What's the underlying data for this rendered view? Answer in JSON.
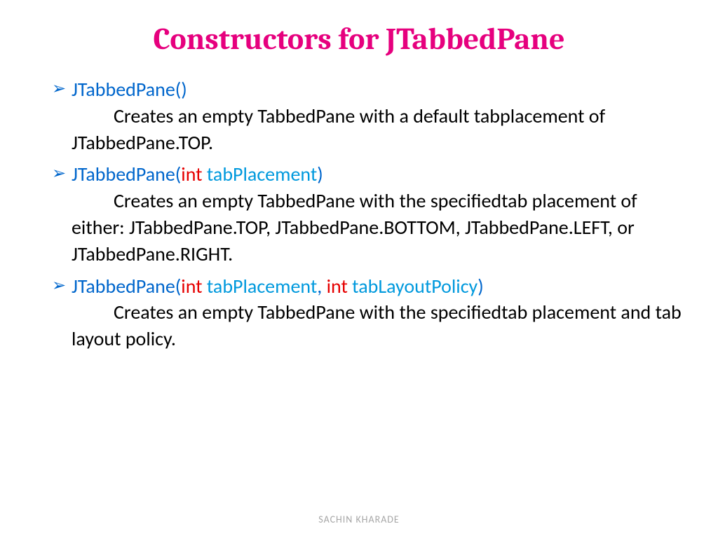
{
  "title": "Constructors for JTabbedPane",
  "items": [
    {
      "sig_open": "JTabbedPane(",
      "sig_close": ")",
      "desc_first": "Creates an empty TabbedPane with a default tab ",
      "desc_rest": "placement of JTabbedPane.TOP."
    },
    {
      "sig_open": "JTabbedPane(",
      "kw1": "int",
      "arg1": " tabPlacement",
      "sig_close": ")",
      "desc_first": "Creates an empty TabbedPane with the specified ",
      "desc_rest": "tab placement of either: JTabbedPane.TOP, JTabbedPane.BOTTOM, JTabbedPane.LEFT, or JTabbedPane.RIGHT."
    },
    {
      "sig_open": "JTabbedPane(",
      "kw1": "int",
      "arg1": " tabPlacement",
      "comma": ", ",
      "kw2": "int",
      "arg2": " tabLayoutPolicy",
      "sig_close": ")",
      "desc_first": "Creates an empty TabbedPane with the specified ",
      "desc_rest": "tab placement and tab layout policy."
    }
  ],
  "footer": "SACHIN KHARADE"
}
